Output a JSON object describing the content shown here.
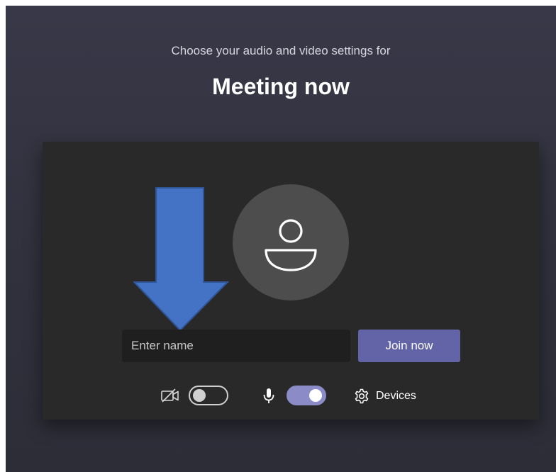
{
  "header": {
    "prompt": "Choose your audio and video settings for",
    "meeting_title": "Meeting now"
  },
  "join_form": {
    "name_placeholder": "Enter name",
    "name_value": "",
    "join_label": "Join now"
  },
  "controls": {
    "camera_enabled": false,
    "camera_icon": "camera-off-icon",
    "mic_enabled": true,
    "mic_icon": "microphone-icon",
    "devices_label": "Devices",
    "devices_icon": "gear-icon"
  },
  "colors": {
    "accent": "#6264a7",
    "toggle_on": "#8b8cc7",
    "panel": "#292929",
    "background": "#33333f"
  }
}
